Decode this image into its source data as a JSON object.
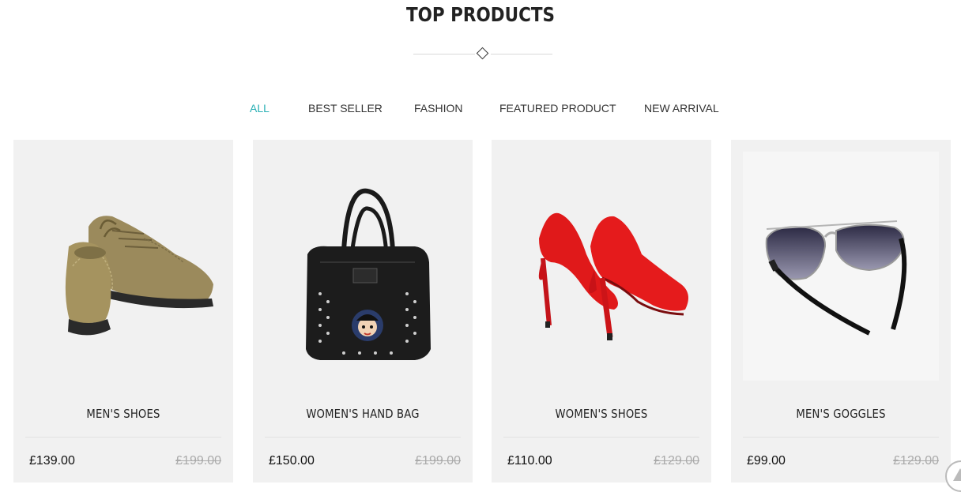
{
  "section": {
    "title": "TOP PRODUCTS"
  },
  "tabs": [
    {
      "label": "ALL",
      "active": true
    },
    {
      "label": "BEST SELLER",
      "active": false
    },
    {
      "label": "FASHION",
      "active": false
    },
    {
      "label": "FEATURED PRODUCT",
      "active": false
    },
    {
      "label": "NEW ARRIVAL",
      "active": false
    }
  ],
  "products": [
    {
      "name": "MEN'S SHOES",
      "price": "£139.00",
      "old_price": "£199.00",
      "icon": "mens-shoes-image"
    },
    {
      "name": "WOMEN'S HAND BAG",
      "price": "£150.00",
      "old_price": "£199.00",
      "icon": "handbag-image"
    },
    {
      "name": "WOMEN'S SHOES",
      "price": "£110.00",
      "old_price": "£129.00",
      "icon": "womens-shoes-image"
    },
    {
      "name": "MEN'S GOGGLES",
      "price": "£99.00",
      "old_price": "£129.00",
      "icon": "sunglasses-image"
    }
  ],
  "colors": {
    "accent": "#2ab0b5",
    "card_bg": "#f1f1f1",
    "old_price": "#aaaaaa"
  }
}
